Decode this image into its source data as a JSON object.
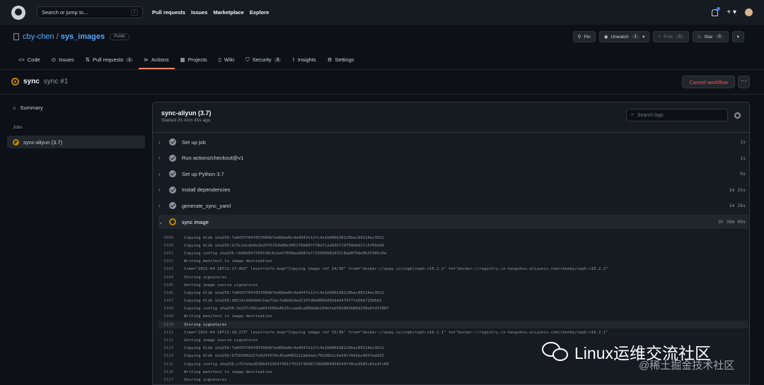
{
  "topbar": {
    "search_placeholder": "Search or jump to...",
    "search_key": "/",
    "nav": [
      "Pull requests",
      "Issues",
      "Marketplace",
      "Explore"
    ],
    "plus": "+ ▾"
  },
  "repo": {
    "owner": "cby-chen",
    "separator": "/",
    "name": "sys_images",
    "visibility": "Public",
    "pin_label": "Pin",
    "unwatch_label": "Unwatch",
    "unwatch_count": "1",
    "fork_label": "Fork",
    "fork_count": "0",
    "star_label": "Star",
    "star_count": "0"
  },
  "tabs": [
    {
      "label": "Code",
      "count": ""
    },
    {
      "label": "Issues",
      "count": ""
    },
    {
      "label": "Pull requests",
      "count": "1"
    },
    {
      "label": "Actions",
      "count": ""
    },
    {
      "label": "Projects",
      "count": ""
    },
    {
      "label": "Wiki",
      "count": ""
    },
    {
      "label": "Security",
      "count": "3"
    },
    {
      "label": "Insights",
      "count": ""
    },
    {
      "label": "Settings",
      "count": ""
    }
  ],
  "run": {
    "workflow": "sync",
    "run_name": "sync #1",
    "cancel_label": "Cancel workflow",
    "more_label": "···"
  },
  "sidebar": {
    "summary_label": "Summary",
    "jobs_label": "Jobs",
    "job_label": "sync-aliyun (3.7)"
  },
  "job": {
    "name": "sync-aliyun (3.7)",
    "started": "Started 2h 41m 45s ago",
    "search_placeholder": "Search logs"
  },
  "steps": [
    {
      "label": "Set up job",
      "duration": "1s",
      "status": "success"
    },
    {
      "label": "Run actions/checkout@v1",
      "duration": "1s",
      "status": "success"
    },
    {
      "label": "Set up Python 3.7",
      "duration": "0s",
      "status": "success"
    },
    {
      "label": "Install dependencies",
      "duration": "1m 25s",
      "status": "success"
    },
    {
      "label": "generate_sync_yaml",
      "duration": "1m 28s",
      "status": "success"
    },
    {
      "label": "sync image",
      "duration": "2h 38m 49s",
      "status": "in_progress"
    }
  ],
  "log_lines": [
    {
      "n": "5099",
      "t": "Copying blob sha256:7a0437f04f83f084b7ed68ad9c4a4947e12fc4e1b006b38129bac89114ec3621"
    },
    {
      "n": "5100",
      "t": "Copying blob sha256:b73c1dcde9e2b2075192b86e305176b60ff78d7c2a03b719750dbd27c5f09e94"
    },
    {
      "n": "5101",
      "t": "Copying config sha256:cb60d59f250fd9c6cbe57690aa0d87aff25068583432l8ab079de0b37495c6e"
    },
    {
      "n": "5102",
      "t": "Writing manifest to image destination"
    },
    {
      "n": "5103",
      "t": "time=\"2022-04-18T12:17:46Z\" level=info msg=\"Copying image ref 14/36\" from=\"docker://quay.io/ceph/ceph:v16.2.2\" to=\"docker://registry.cn-hangzhou.aliyuncs.com/chenby/ceph:v16.2.2\""
    },
    {
      "n": "5104",
      "t": "Storing signatures"
    },
    {
      "n": "5105",
      "t": "Getting image source signatures"
    },
    {
      "n": "5106",
      "t": "Copying blob sha256:7a0437f04f83f084b7ed68ad9c4a4947e12fc4e1b006b38129bac89114ec3621"
    },
    {
      "n": "5107",
      "t": "Copying blob sha256:d8314cddb9d4c5ae72ac7a6b92dad2197d0e006b095ddd479f7fa56b715b6b2"
    },
    {
      "n": "5108",
      "t": "Copying config sha256:5e237c58caa60f606a4b15ccae8ca00bb8e104efeb56b902b89d258a9fd37887"
    },
    {
      "n": "5109",
      "t": "Writing manifest to image destination"
    },
    {
      "n": "5110",
      "t": "Storing signatures"
    },
    {
      "n": "5111",
      "t": "time=\"2022-04-18T12:18:27Z\" level=info msg=\"Copying image ref 15/36\" from=\"docker://quay.io/ceph/ceph:v16.2.1\" to=\"docker://registry.cn-hangzhou.aliyuncs.com/chenby/ceph:v16.2.1\""
    },
    {
      "n": "5112",
      "t": "Getting image source signatures"
    },
    {
      "n": "5113",
      "t": "Copying blob sha256:7a0437f04f83f084b7ed68ad9c4a4947e12fc4e1b006b38129bac89114ec3621"
    },
    {
      "n": "5114",
      "t": "Copying blob sha256:67583902e57e620f634c45ad483212a6dadc792d0b2c9a941f841be403fedd35"
    },
    {
      "n": "5115",
      "t": "Copying config sha256:c757e4a3636b4319547961f7013f3658719b0864050544ff8ce3585c01e4fc60"
    },
    {
      "n": "5116",
      "t": "Writing manifest to image destination"
    },
    {
      "n": "5117",
      "t": "Storing signatures"
    }
  ],
  "watermark": {
    "main": "Linux运维交流社区",
    "sub": "@稀土掘金技术社区"
  },
  "colors": {
    "background": "#0d1117",
    "in_progress": "#bf8700",
    "link": "#58a6ff",
    "danger": "#f85149",
    "active_tab": "#f78166"
  }
}
